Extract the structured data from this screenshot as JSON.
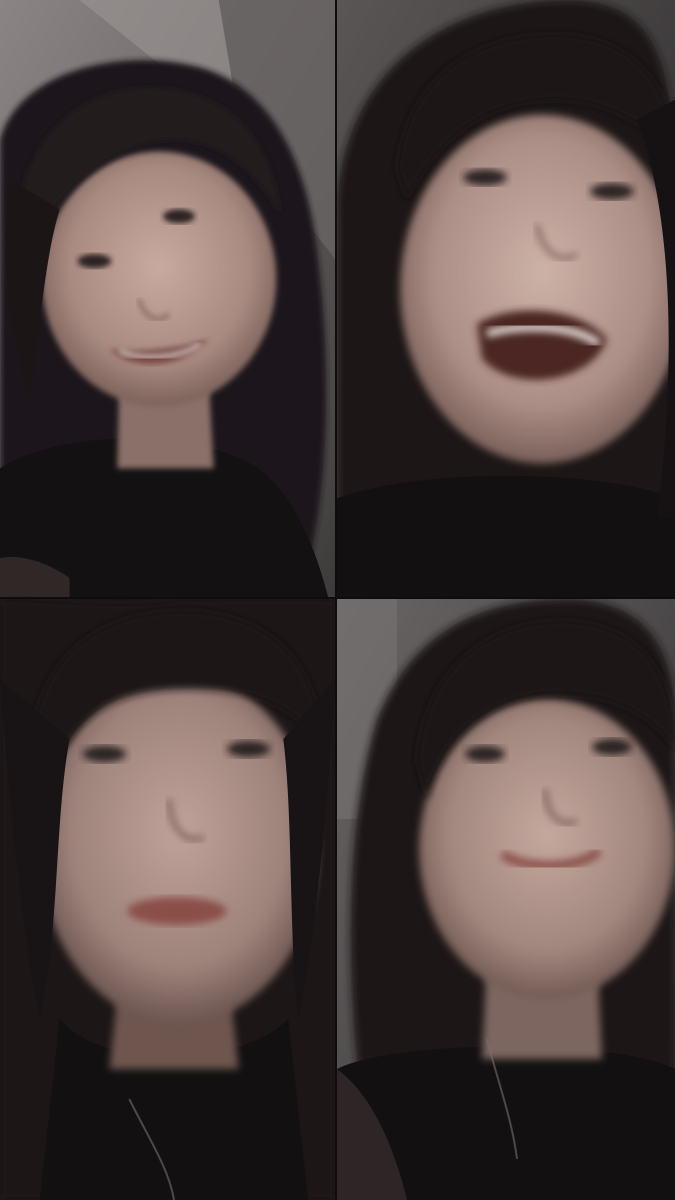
{
  "call": {
    "layout": "2x2-grid",
    "participant_count": 4
  },
  "participants": [
    {
      "tile": "top-left",
      "video_on": true
    },
    {
      "tile": "top-right",
      "video_on": true
    },
    {
      "tile": "bottom-left",
      "video_on": true
    },
    {
      "tile": "bottom-right",
      "video_on": true
    }
  ],
  "colors": {
    "background": "#0d0c0e",
    "wall_tl": "#6e6a69",
    "wall_tr": "#4a4747",
    "wall_bl": "#3b393a",
    "wall_br": "#5a5757",
    "hair": "#1b1617",
    "skin": "#b89c92"
  }
}
